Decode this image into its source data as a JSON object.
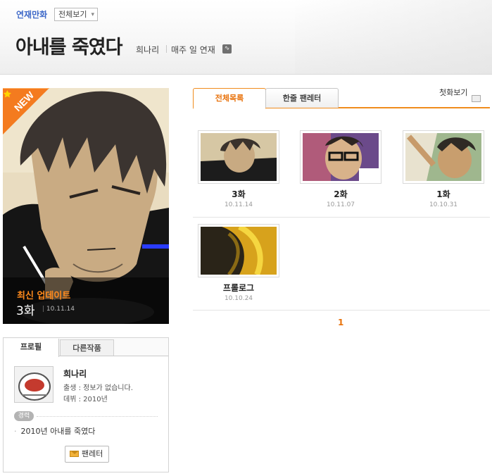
{
  "header": {
    "category": "연재만화",
    "view_all": "전체보기",
    "title": "아내를 죽였다",
    "author": "희나리",
    "schedule": "매주 일 연재",
    "rss_icon": "rss-icon"
  },
  "feature": {
    "badge": "NEW",
    "latest_label": "최신 업데이트",
    "latest_episode": "3화",
    "latest_date": "10.11.14"
  },
  "profile": {
    "tabs": [
      "프로필",
      "다른작품"
    ],
    "name": "희나리",
    "born": "출생 : 정보가 없습니다.",
    "debut": "데뷔 : 2010년",
    "career_label": "경력",
    "career_items": [
      "2010년 아내를 죽였다"
    ],
    "letter_button": "팬레터"
  },
  "episodes": {
    "tabs": [
      "전체목록",
      "한줄 팬레터"
    ],
    "first_episode": "첫화보기",
    "items": [
      {
        "name": "3화",
        "date": "10.11.14"
      },
      {
        "name": "2화",
        "date": "10.11.07"
      },
      {
        "name": "1화",
        "date": "10.10.31"
      },
      {
        "name": "프롤로그",
        "date": "10.10.24"
      }
    ],
    "page": "1"
  },
  "colors": {
    "accent": "#f08c1d",
    "link": "#3d68c8"
  }
}
